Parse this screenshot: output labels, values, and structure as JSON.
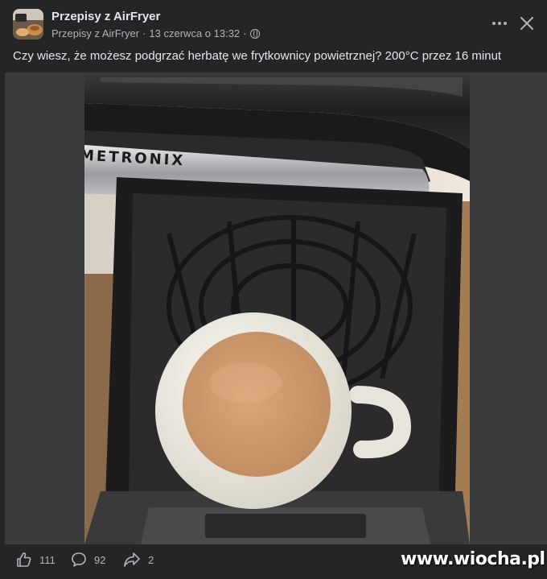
{
  "post": {
    "page_name": "Przepisy z AirFryer",
    "meta_author": "Przepisy z AirFryer",
    "meta_separator": "·",
    "meta_date": "13 czerwca o 13:32",
    "meta_separator2": "·",
    "caption": "Czy wiesz, że możesz podgrzać herbatę we frytkownicy powietrznej? 200°C przez 16 minut",
    "photo_brand_text": "METRONIX"
  },
  "actions": {
    "likes_count": "111",
    "comments_count": "92",
    "shares_count": "2"
  },
  "icons": {
    "more": "more-horizontal-icon",
    "close": "close-icon",
    "globe": "globe-icon",
    "like": "thumbs-up-icon",
    "comment": "comment-bubble-icon",
    "share": "share-arrow-icon"
  },
  "watermark": "www.wiocha.pl",
  "colors": {
    "background": "#242526",
    "photo_frame": "#3a3b3c",
    "primary_text": "#e4e6eb",
    "secondary_text": "#b0b3b8"
  }
}
